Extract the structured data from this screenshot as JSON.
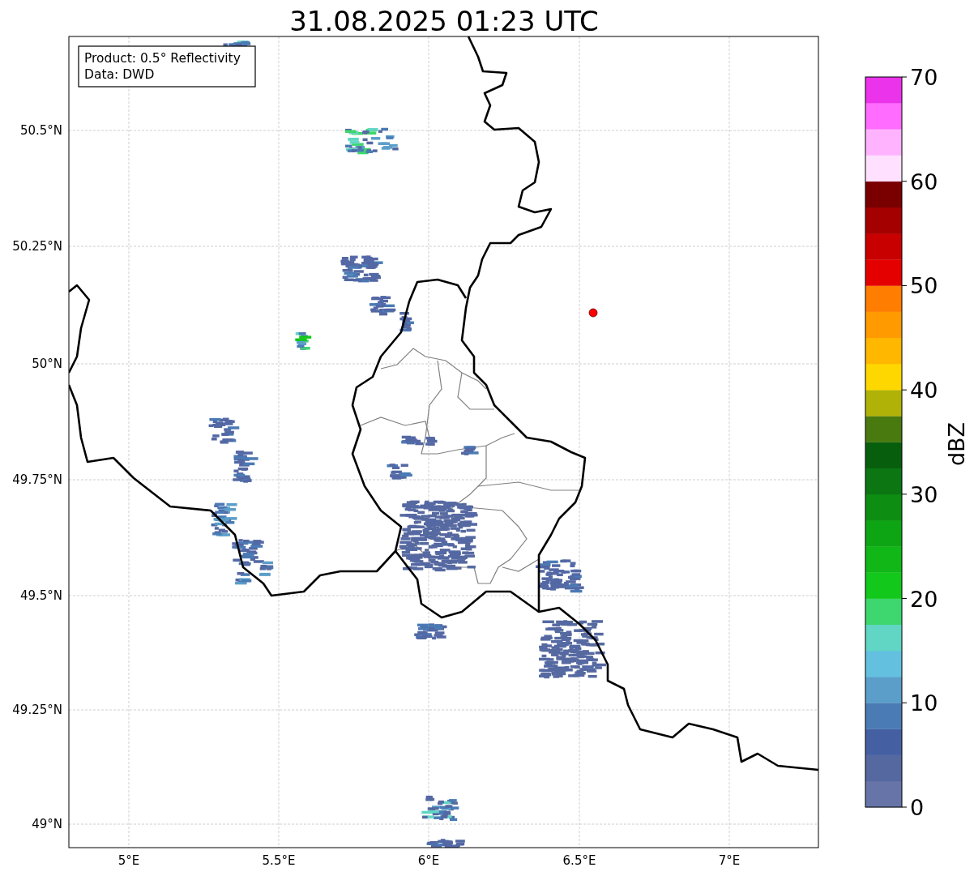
{
  "title": "31.08.2025 01:23 UTC",
  "info_box": {
    "lines": [
      "Product: 0.5° Reflectivity",
      "Data: DWD"
    ]
  },
  "map": {
    "lat_labels": [
      "50.5°N",
      "50.25°N",
      "50°N",
      "49.75°N",
      "49.5°N",
      "49.25°N",
      "49°N"
    ],
    "lon_labels": [
      "5°E",
      "5.5°E",
      "6°E",
      "6.5°E",
      "7°E"
    ]
  },
  "colorbar": {
    "label": "dBZ",
    "ticks": [
      "70",
      "60",
      "50",
      "40",
      "30",
      "20",
      "10",
      "0"
    ],
    "segments": [
      {
        "color": "#6674a8"
      },
      {
        "color": "#5568a0"
      },
      {
        "color": "#4460a3"
      },
      {
        "color": "#4a7bb5"
      },
      {
        "color": "#5b9ec9"
      },
      {
        "color": "#63c1df"
      },
      {
        "color": "#62d6c4"
      },
      {
        "color": "#3ed66e"
      },
      {
        "color": "#12c81a"
      },
      {
        "color": "#10b716"
      },
      {
        "color": "#0ea514"
      },
      {
        "color": "#0d8e12"
      },
      {
        "color": "#0b7612"
      },
      {
        "color": "#075e0d"
      },
      {
        "color": "#497a10"
      },
      {
        "color": "#b0b208"
      },
      {
        "color": "#ffd700"
      },
      {
        "color": "#ffb700"
      },
      {
        "color": "#ff9a00"
      },
      {
        "color": "#ff7d00"
      },
      {
        "color": "#e50000"
      },
      {
        "color": "#c80000"
      },
      {
        "color": "#a40000"
      },
      {
        "color": "#7a0000"
      },
      {
        "color": "#ffe0ff"
      },
      {
        "color": "#ffb3ff"
      },
      {
        "color": "#ff6cff"
      },
      {
        "color": "#ea33ea"
      }
    ]
  }
}
